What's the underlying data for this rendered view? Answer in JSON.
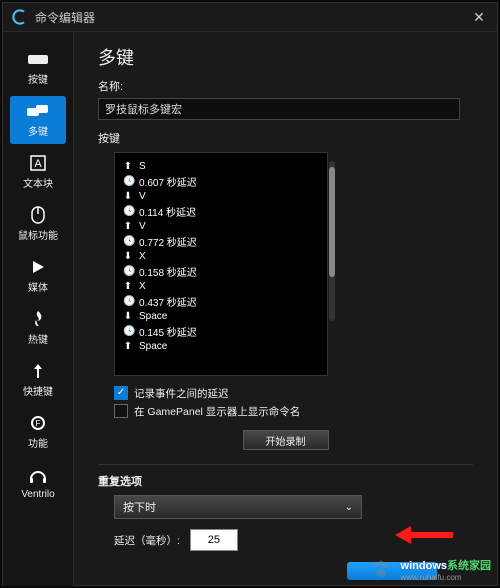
{
  "window": {
    "title": "命令编辑器"
  },
  "sidebar": {
    "items": [
      {
        "label": "按键"
      },
      {
        "label": "多键"
      },
      {
        "label": "文本块"
      },
      {
        "label": "鼠标功能"
      },
      {
        "label": "媒体"
      },
      {
        "label": "热键"
      },
      {
        "label": "快捷键"
      },
      {
        "label": "功能"
      },
      {
        "label": "Ventrilo"
      }
    ]
  },
  "main": {
    "page_title": "多键",
    "name_label": "名称:",
    "name_value": "罗技鼠标多键宏",
    "keys_label": "按键",
    "key_events": [
      {
        "icon": "up",
        "text": "S"
      },
      {
        "icon": "clock",
        "text": "0.607 秒延迟"
      },
      {
        "icon": "down",
        "text": "V"
      },
      {
        "icon": "clock",
        "text": "0.114 秒延迟"
      },
      {
        "icon": "up",
        "text": "V"
      },
      {
        "icon": "clock",
        "text": "0.772 秒延迟"
      },
      {
        "icon": "down",
        "text": "X"
      },
      {
        "icon": "clock",
        "text": "0.158 秒延迟"
      },
      {
        "icon": "up",
        "text": "X"
      },
      {
        "icon": "clock",
        "text": "0.437 秒延迟"
      },
      {
        "icon": "down",
        "text": "Space"
      },
      {
        "icon": "clock",
        "text": "0.145 秒延迟"
      },
      {
        "icon": "up",
        "text": "Space"
      }
    ],
    "check_record_delay": "记录事件之间的延迟",
    "check_gamepanel": "在 GamePanel 显示器上显示命令名",
    "start_record": "开始录制",
    "repeat_section": "重复选项",
    "repeat_mode": "按下时",
    "delay_label": "延迟（毫秒）:",
    "delay_value": "25"
  },
  "watermark": {
    "a": "windows",
    "b": "系统家园",
    "url": "www.ruhaifu.com"
  }
}
